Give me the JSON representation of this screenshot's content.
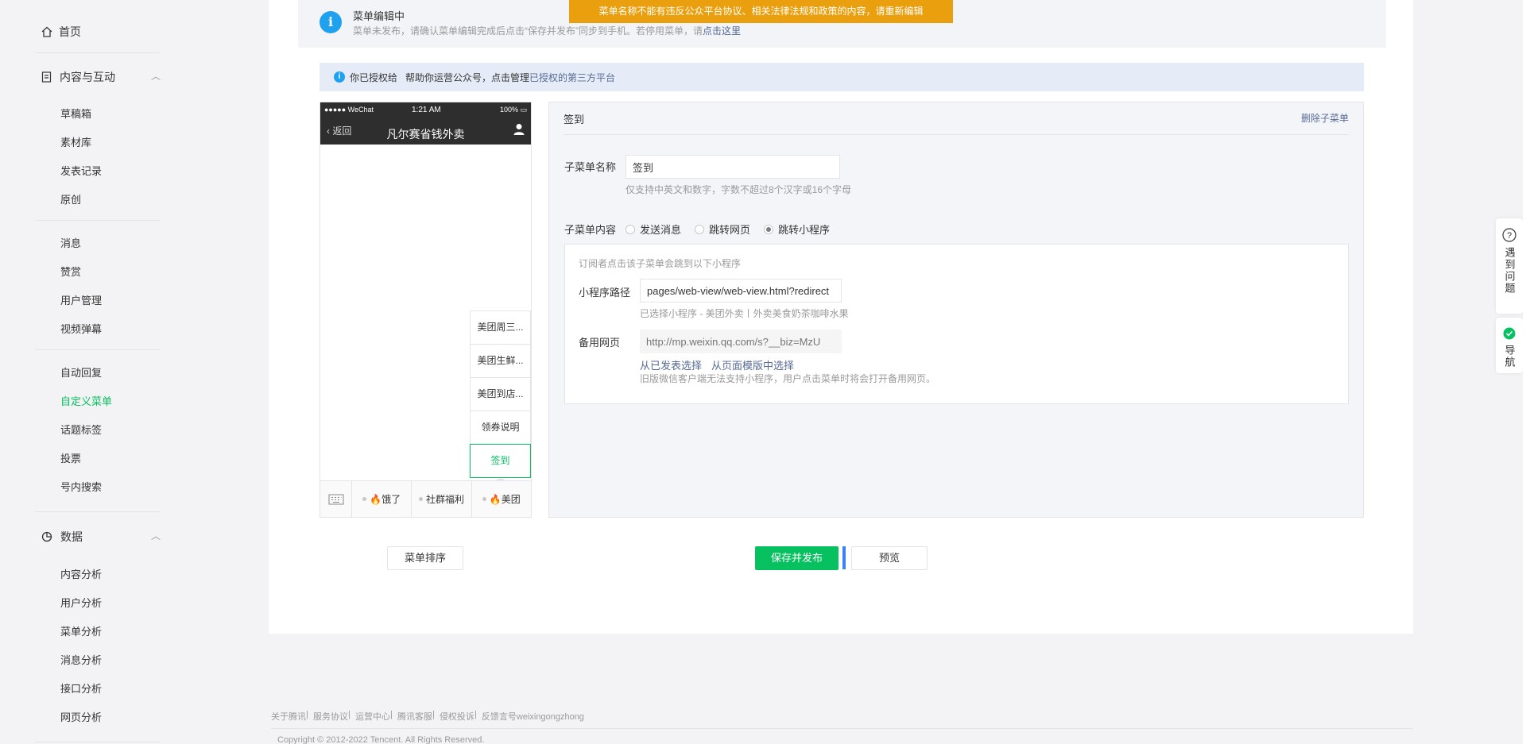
{
  "sidebar": {
    "home": "首页",
    "groups": [
      {
        "title": "内容与互动",
        "items": [
          "草稿箱",
          "素材库",
          "发表记录",
          "原创"
        ]
      },
      {
        "items": [
          "消息",
          "赞赏",
          "用户管理",
          "视频弹幕"
        ]
      },
      {
        "items": [
          "自动回复",
          "自定义菜单",
          "话题标签",
          "投票",
          "号内搜索"
        ]
      },
      {
        "title": "数据",
        "items": [
          "内容分析",
          "用户分析",
          "菜单分析",
          "消息分析",
          "接口分析",
          "网页分析"
        ]
      }
    ],
    "active": "自定义菜单"
  },
  "status_box": {
    "title": "菜单编辑中",
    "desc": "菜单未发布，请确认菜单编辑完成后点击“保存并发布”同步到手机。若停用菜单，请",
    "link": "点击这里"
  },
  "warning": "菜单名称不能有违反公众平台协议、相关法律法规和政策的内容，请重新编辑",
  "auth_bar": {
    "prefix": "你已授权给",
    "text": "帮助你运营公众号，点击管理",
    "link": "已授权的第三方平台"
  },
  "phone": {
    "status_left": "●●●●● WeChat",
    "time": "1:21 AM",
    "battery": "100%",
    "back": "返回",
    "title": "凡尔赛省钱外卖",
    "submenu": [
      "美团周三...",
      "美团生鲜...",
      "美团到店...",
      "领券说明",
      "签到"
    ],
    "tabs": [
      "🔥饿了",
      "社群福利",
      "🔥美团"
    ]
  },
  "editor": {
    "head": "签到",
    "delete": "删除子菜单",
    "name_label": "子菜单名称",
    "name_value": "签到",
    "name_hint": "仅支持中英文和数字，字数不超过8个汉字或16个字母",
    "content_label": "子菜单内容",
    "options": [
      "发送消息",
      "跳转网页",
      "跳转小程序"
    ],
    "selected_option": "跳转小程序",
    "mp": {
      "intro": "订阅者点击该子菜单会跳到以下小程序",
      "path_label": "小程序路径",
      "path_value": "pages/web-view/web-view.html?redirect",
      "selected": "已选择小程序 - 美团外卖丨外卖美食奶茶咖啡水果",
      "backup_label": "备用网页",
      "backup_placeholder": "http://mp.weixin.qq.com/s?__biz=MzU",
      "link1": "从已发表选择",
      "link2": "从页面模版中选择",
      "note": "旧版微信客户端无法支持小程序，用户点击菜单时将会打开备用网页。"
    }
  },
  "buttons": {
    "sort": "菜单排序",
    "publish": "保存并发布",
    "preview": "预览"
  },
  "footer": {
    "links": [
      "关于腾讯",
      "服务协议",
      "运营中心",
      "腾讯客服",
      "侵权投诉",
      "反馈言号weixingongzhong"
    ],
    "copyright": "Copyright © 2012-2022 Tencent. All Rights Reserved."
  },
  "float": {
    "help": "遇到问题",
    "nav": "导航"
  }
}
